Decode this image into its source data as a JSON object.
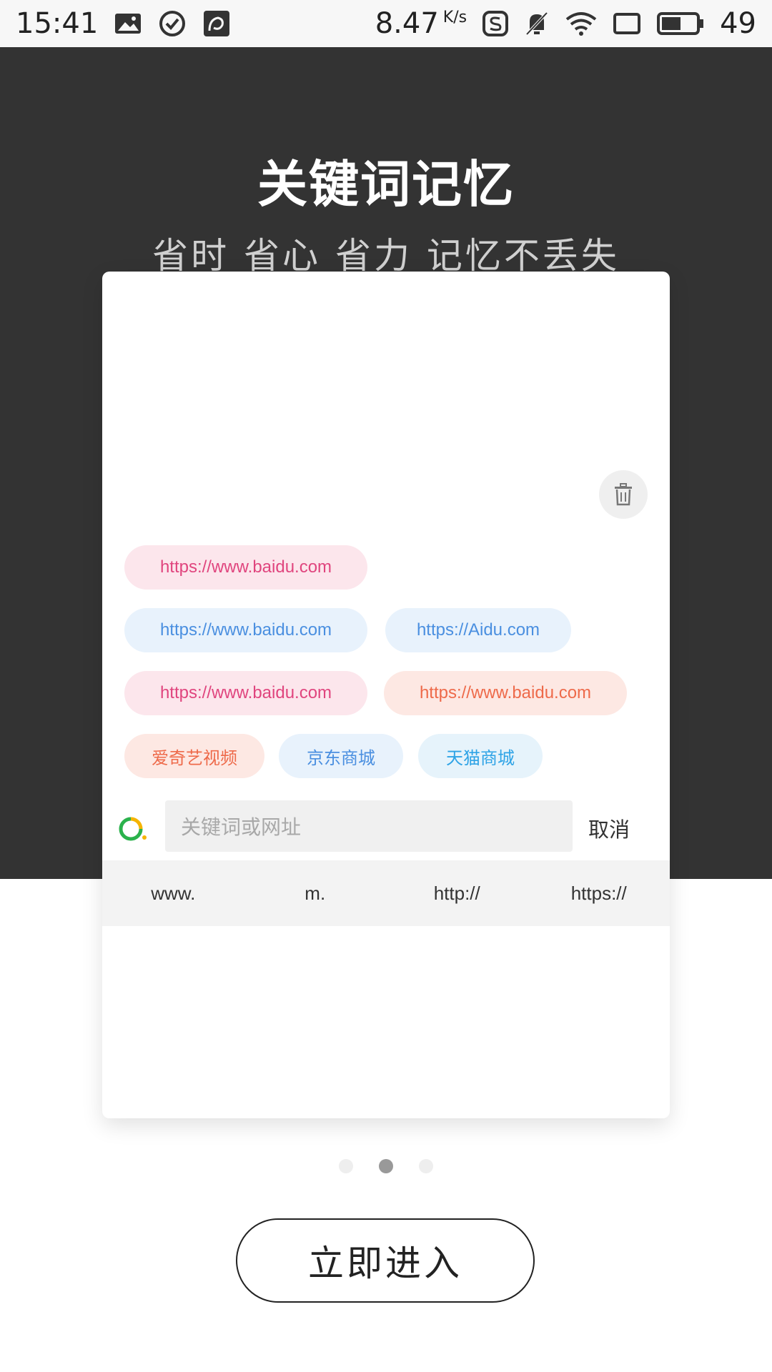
{
  "status_bar": {
    "time": "15:41",
    "net_speed": "8.47",
    "net_speed_unit": "K/s",
    "battery": "49"
  },
  "hero": {
    "title": "关键词记忆",
    "subtitle": "省时 省心 省力 记忆不丢失"
  },
  "card": {
    "chips": [
      {
        "label": "https://www.baidu.com",
        "color": "pink"
      },
      {
        "label": "https://www.baidu.com",
        "color": "blue"
      },
      {
        "label": "https://Aidu.com",
        "color": "blue"
      },
      {
        "label": "https://www.baidu.com",
        "color": "pink"
      },
      {
        "label": "https://www.baidu.com",
        "color": "peach"
      },
      {
        "label": "爱奇艺视频",
        "color": "peach"
      },
      {
        "label": "京东商城",
        "color": "blue"
      },
      {
        "label": "天猫商城",
        "color": "skyblue"
      }
    ],
    "search": {
      "placeholder": "关键词或网址",
      "cancel_label": "取消"
    },
    "prefixes": [
      "www.",
      "m.",
      "http://",
      "https://"
    ]
  },
  "pager": {
    "total": 3,
    "active_index": 1
  },
  "enter_button": "立即进入",
  "colors": {
    "hero_bg": "#333333",
    "chip_pink": "#e0457e",
    "chip_blue": "#4a8fe0",
    "chip_peach": "#ee6a4a",
    "chip_skyblue": "#2ea3e6"
  }
}
